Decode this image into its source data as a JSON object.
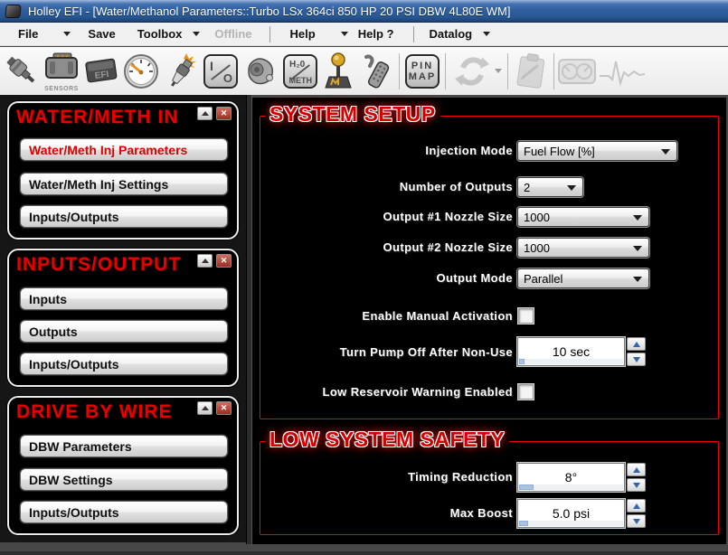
{
  "window": {
    "title": "Holley EFI - [Water/Methanol Parameters::Turbo LSx 364ci 850 HP 20 PSI DBW 4L80E WM]"
  },
  "menu": {
    "file": "File",
    "save": "Save",
    "toolbox": "Toolbox",
    "offline": "Offline",
    "help": "Help",
    "help2": "Help ?",
    "datalog": "Datalog"
  },
  "toolbar": {
    "icon_names": [
      "injector-icon",
      "sensors-icon",
      "efi-module-icon",
      "gauge-icon",
      "spark-plug-icon",
      "io-icon",
      "pump-icon",
      "h2o-meth-icon",
      "shifter-icon",
      "harness-icon",
      "pin-map-icon",
      "sync-icon",
      "clipboard-icon",
      "gauges-icon",
      "heartbeat-icon"
    ],
    "labels": {
      "sensors": "SENSORS",
      "efi": "EFI",
      "io_left": "I",
      "io_right": "O",
      "h2o_top": "H₂0",
      "h2o_bottom": "METH",
      "pin_top": "PIN",
      "pin_bottom": "MAP"
    }
  },
  "sidebar": {
    "panels": [
      {
        "title": "WATER/METH IN",
        "buttons": [
          {
            "label": "Water/Meth Inj Parameters",
            "active": true
          },
          {
            "label": "Water/Meth Inj Settings",
            "active": false
          },
          {
            "label": "Inputs/Outputs",
            "active": false
          }
        ]
      },
      {
        "title": "INPUTS/OUTPUT",
        "buttons": [
          {
            "label": "Inputs",
            "active": false
          },
          {
            "label": "Outputs",
            "active": false
          },
          {
            "label": "Inputs/Outputs",
            "active": false
          }
        ]
      },
      {
        "title": "DRIVE BY WIRE",
        "buttons": [
          {
            "label": "DBW Parameters",
            "active": false
          },
          {
            "label": "DBW Settings",
            "active": false
          },
          {
            "label": "Inputs/Outputs",
            "active": false
          }
        ]
      }
    ]
  },
  "main": {
    "system_setup": {
      "title": "SYSTEM SETUP",
      "injection_mode": {
        "label": "Injection Mode",
        "value": "Fuel Flow [%]"
      },
      "number_of_outputs": {
        "label": "Number of Outputs",
        "value": "2"
      },
      "output1_nozzle": {
        "label": "Output #1 Nozzle Size",
        "value": "1000"
      },
      "output2_nozzle": {
        "label": "Output #2 Nozzle Size",
        "value": "1000"
      },
      "output_mode": {
        "label": "Output Mode",
        "value": "Parallel"
      },
      "enable_manual_activation": {
        "label": "Enable Manual Activation",
        "checked": false
      },
      "pump_off_after": {
        "label": "Turn Pump Off After Non-Use",
        "value": "10 sec"
      },
      "low_reservoir_warning": {
        "label": "Low Reservoir Warning Enabled",
        "checked": false
      }
    },
    "low_system_safety": {
      "title": "LOW SYSTEM SAFETY",
      "timing_reduction": {
        "label": "Timing Reduction",
        "value": "8°"
      },
      "max_boost": {
        "label": "Max Boost",
        "value": "5.0 psi"
      }
    }
  },
  "colors": {
    "accent_red": "#ff0000",
    "titlebar_blue": "#30609f",
    "panel_title_red": "#e60000",
    "spinner_thumb_blue": "#a8c4e2"
  }
}
